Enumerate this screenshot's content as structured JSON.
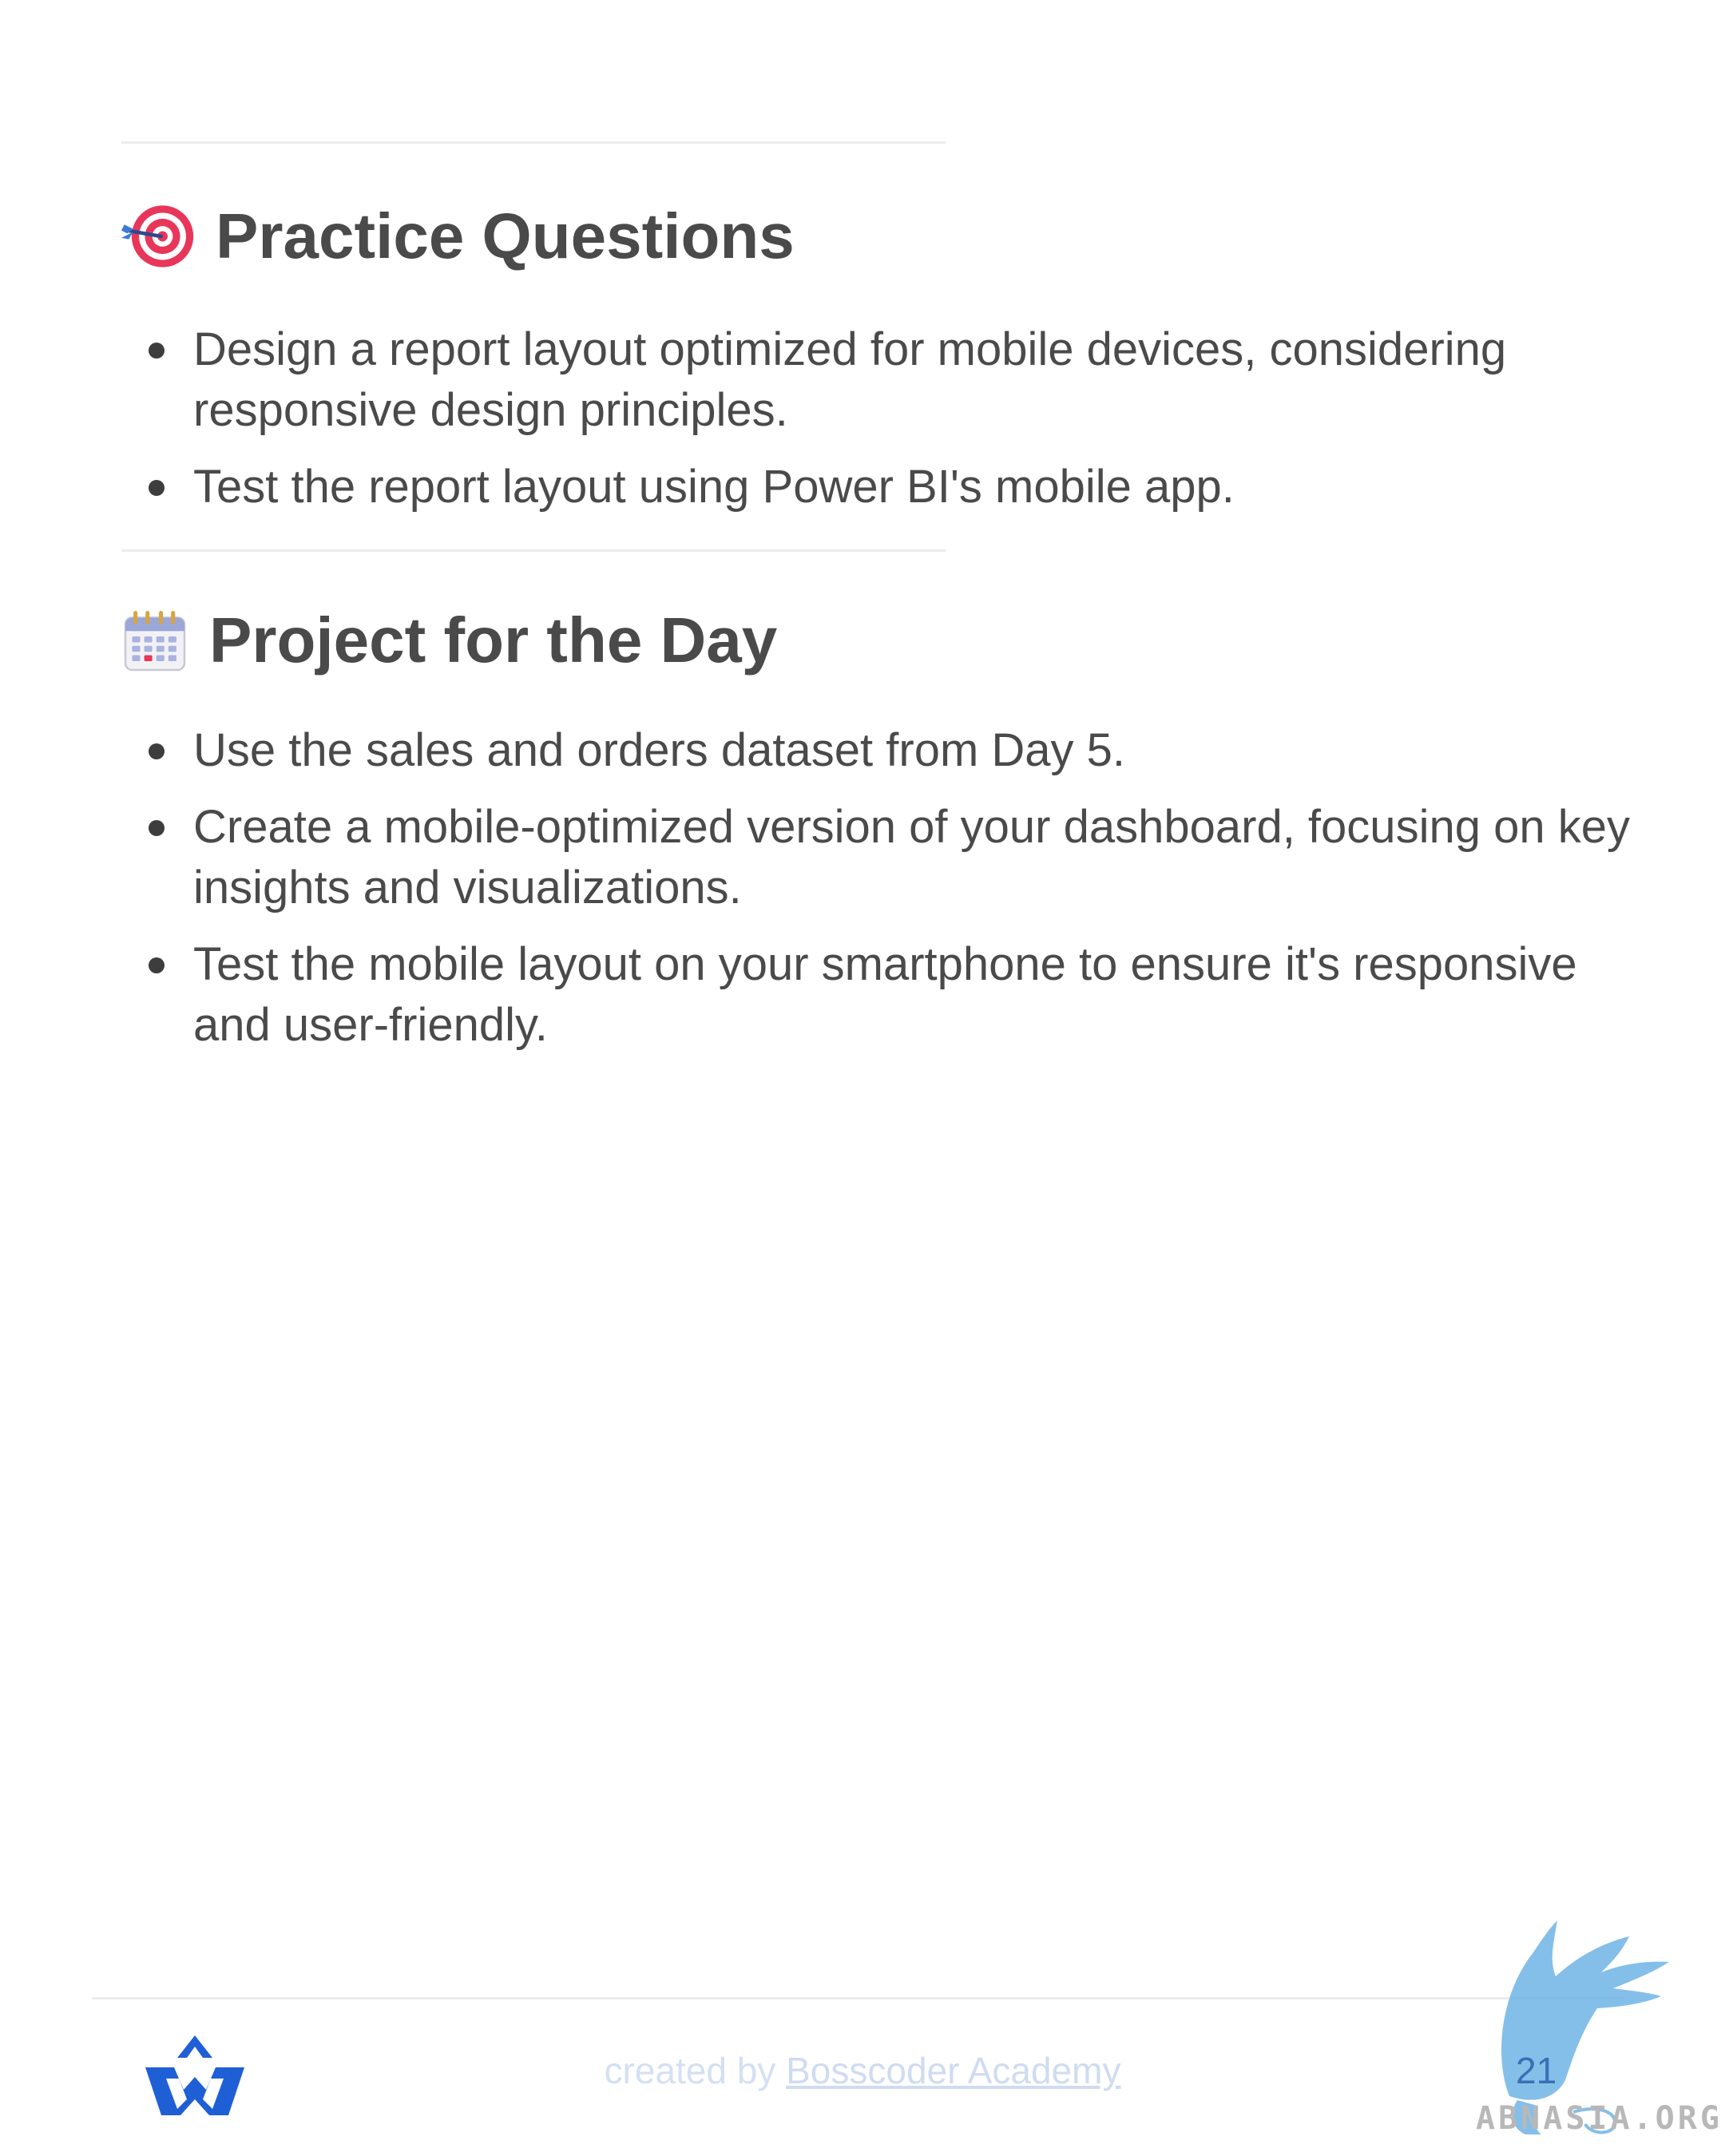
{
  "practice": {
    "title": "Practice Questions",
    "icon": "target-icon",
    "items": [
      {
        "text": "Design a report layout optimized for mobile devices, considering responsive design principles."
      },
      {
        "text": "Test the report layout using Power BI's mobile app."
      }
    ]
  },
  "project": {
    "title": "Project for the Day",
    "icon": "calendar-icon",
    "items": [
      {
        "text": "Use the sales and orders dataset from Day 5."
      },
      {
        "text": "Create a mobile-optimized version of your dashboard, focusing on key insights and visualizations."
      },
      {
        "text": "Test the mobile layout on your smartphone to ensure it's responsive and user-friendly."
      }
    ]
  },
  "footer": {
    "credit_prefix": "created by ",
    "credit_brand": "Bosscoder Academy",
    "page_number": "21"
  },
  "watermark": {
    "text": "ABNASIA.ORG"
  },
  "colors": {
    "text": "#4a4a4a",
    "footer_text": "#d4e0f2",
    "page_number": "#3a6fb5",
    "logo_blue": "#1f5fd6"
  }
}
